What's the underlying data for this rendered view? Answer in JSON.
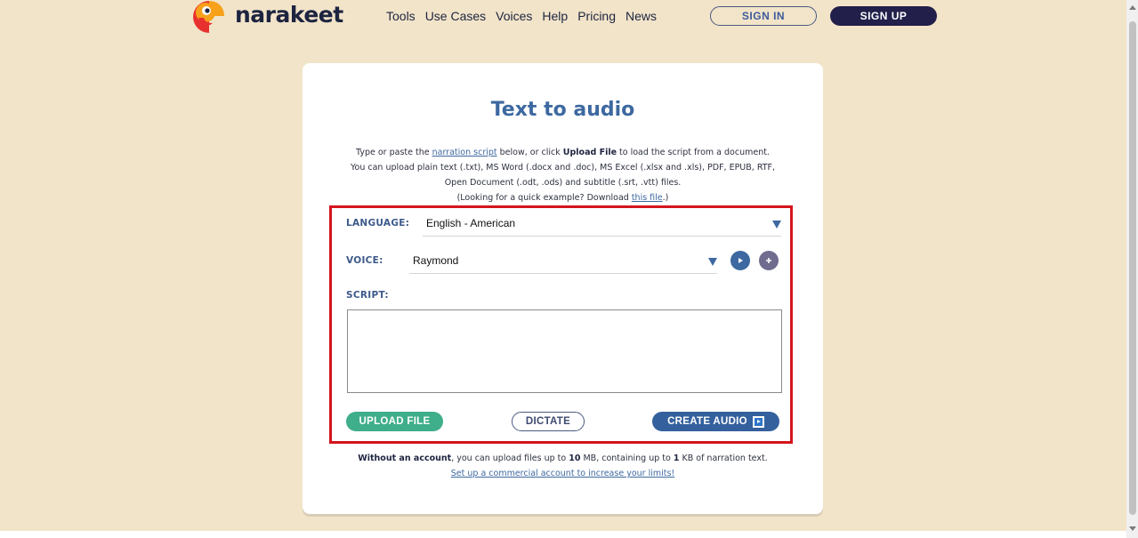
{
  "header": {
    "logo_text": "narakeet",
    "logo_icon": "parrot-logo-icon",
    "nav": [
      "Tools",
      "Use Cases",
      "Voices",
      "Help",
      "Pricing",
      "News"
    ],
    "sign_in": "SIGN IN",
    "sign_up": "SIGN UP"
  },
  "card": {
    "title": "Text to audio",
    "intro": {
      "l1_pre": "Type or paste the ",
      "l1_link": "narration script",
      "l1_mid": " below, or click ",
      "l1_bold": "Upload File",
      "l1_post": " to load the script from a document.",
      "l2": "You can upload plain text (.txt), MS Word (.docx and .doc), MS Excel (.xlsx and .xls), PDF, EPUB, RTF,",
      "l3": "Open Document (.odt, .ods) and subtitle (.srt, .vtt) files.",
      "l4_pre": "(Looking for a quick example? Download ",
      "l4_link": "this file",
      "l4_post": ".)"
    },
    "form": {
      "language_label": "LANGUAGE:",
      "language_value": "English - American",
      "voice_label": "VOICE:",
      "voice_value": "Raymond",
      "script_label": "SCRIPT:",
      "script_value": "",
      "upload_button": "UPLOAD FILE",
      "dictate_button": "DICTATE",
      "create_button": "CREATE AUDIO"
    },
    "footer": {
      "bold": "Without an account",
      "pre": ", you can upload files up to ",
      "size": "10",
      "mid1": " MB, containing up to ",
      "kb": "1",
      "post": " KB of narration text.",
      "link": "Set up a commercial account to increase your limits!"
    }
  },
  "colors": {
    "background": "#f2e4c9",
    "title": "#3d68a0",
    "highlight_box": "#d4151c",
    "upload": "#3fae8a",
    "create": "#34609e",
    "signup": "#221f4b"
  }
}
